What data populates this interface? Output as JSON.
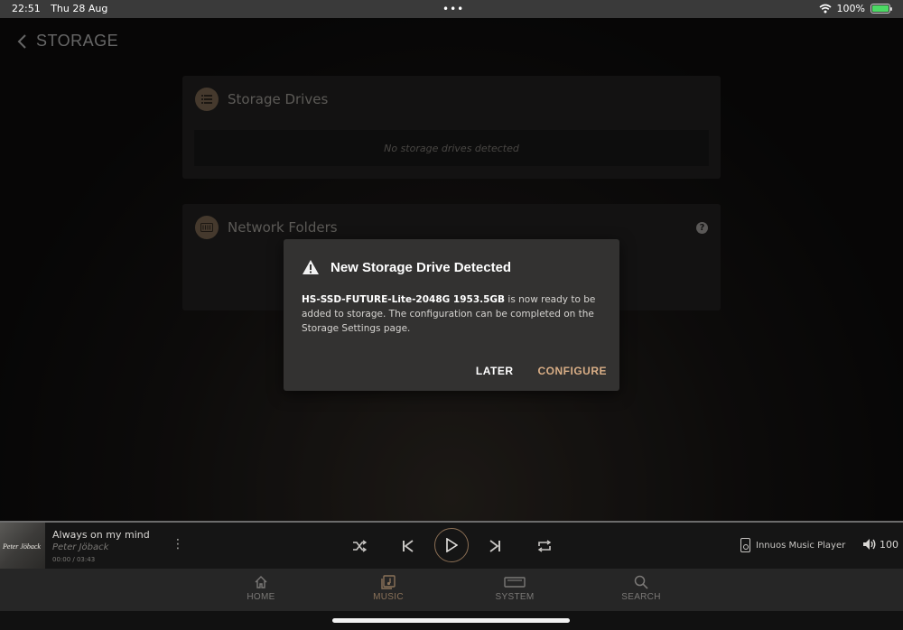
{
  "status_bar": {
    "time": "22:51",
    "date": "Thu 28 Aug",
    "multitask_dots": "•••",
    "battery_percent": "100%",
    "icons": [
      "wifi-icon",
      "battery-charging-icon"
    ]
  },
  "header": {
    "back_icon": "chevron-left-icon",
    "title": "STORAGE"
  },
  "storage_drives": {
    "title": "Storage Drives",
    "icon": "list-icon",
    "empty_message": "No storage drives detected"
  },
  "network_folders": {
    "title": "Network Folders",
    "icon": "network-drive-icon",
    "help_glyph": "?"
  },
  "dialog": {
    "icon": "warning-icon",
    "title": "New Storage Drive Detected",
    "drive_name": "HS-SSD-FUTURE-Lite-2048G 1953.5GB",
    "message": " is now ready to be added to storage. The configuration can be completed on the Storage Settings page.",
    "later_label": "LATER",
    "configure_label": "CONFIGURE"
  },
  "player": {
    "cover_text": "Peter Jöback",
    "track_title": "Always on my mind",
    "artist": "Peter Jöback",
    "time": "00:00 / 03:43",
    "controls": [
      "shuffle-icon",
      "previous-icon",
      "play-icon",
      "next-icon",
      "repeat-icon"
    ],
    "device_name": "Innuos Music Player",
    "volume": "100"
  },
  "tabs": [
    {
      "label": "HOME",
      "icon": "home-icon"
    },
    {
      "label": "MUSIC",
      "icon": "music-library-icon"
    },
    {
      "label": "SYSTEM",
      "icon": "system-device-icon"
    },
    {
      "label": "SEARCH",
      "icon": "search-icon"
    }
  ],
  "colors": {
    "accent": "#d9ae86",
    "tab_active": "#8a7259",
    "card_bg": "#1e1d1c",
    "dialog_bg": "#333231"
  }
}
